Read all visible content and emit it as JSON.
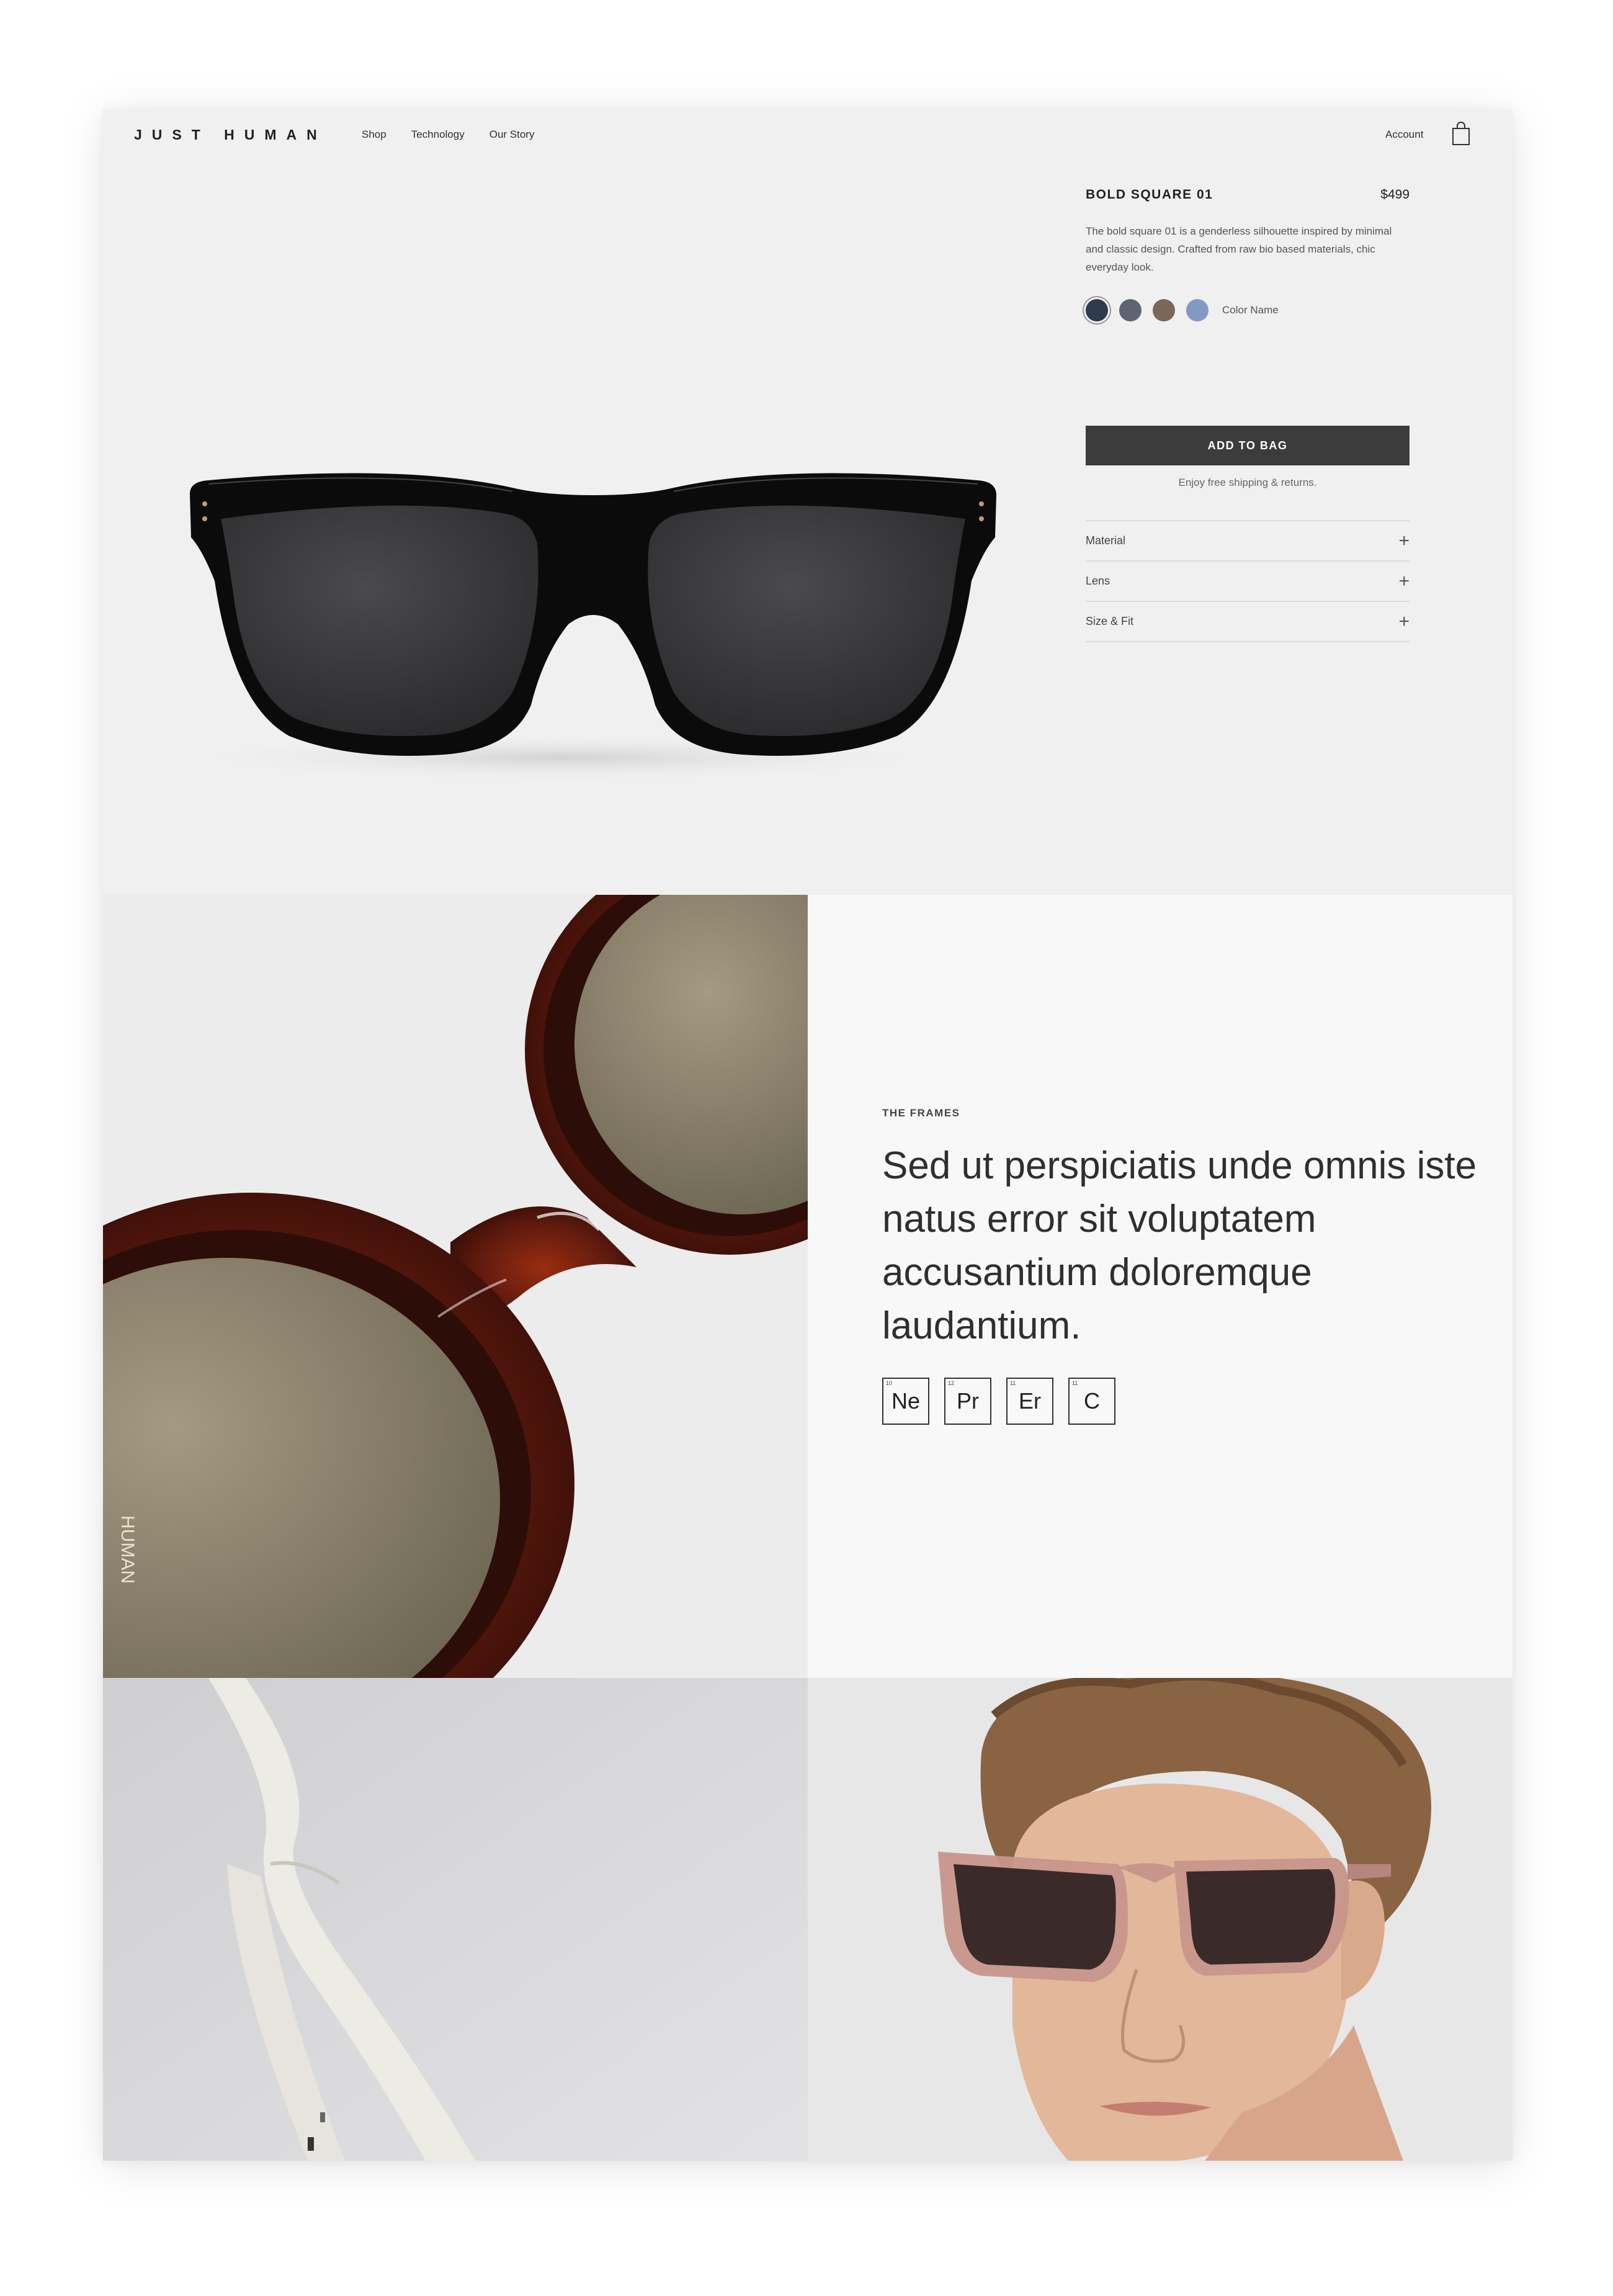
{
  "header": {
    "logo": "JUST HUMAN",
    "nav": [
      "Shop",
      "Technology",
      "Our Story"
    ],
    "account": "Account",
    "bag_icon": "shopping-bag-icon"
  },
  "product": {
    "name": "BOLD SQUARE 01",
    "price": "$499",
    "description": "The bold square 01 is a genderless silhouette inspired by minimal and classic design. Crafted from raw bio based materials, chic everyday look.",
    "swatches": [
      {
        "color": "#2e3a4e",
        "selected": true
      },
      {
        "color": "#5f6473",
        "selected": false
      },
      {
        "color": "#7c6656",
        "selected": false
      },
      {
        "color": "#8299c2",
        "selected": false
      }
    ],
    "color_name": "Color Name",
    "add_to_bag": "ADD TO BAG",
    "shipping_note": "Enjoy free shipping & returns.",
    "accordion": [
      "Material",
      "Lens",
      "Size & Fit"
    ],
    "accordion_icon": "plus-icon"
  },
  "frames": {
    "eyebrow": "THE FRAMES",
    "headline": "Sed ut perspiciatis unde omnis iste natus error sit voluptatem accusantium doloremque laudantium.",
    "elements": [
      {
        "symbol": "Ne",
        "number": "10"
      },
      {
        "symbol": "Pr",
        "number": "12"
      },
      {
        "symbol": "Er",
        "number": "11"
      },
      {
        "symbol": "C",
        "number": "11"
      }
    ],
    "temple_imprint": "HUMAN"
  },
  "colors": {
    "page_bg": "#f0f0f0",
    "button": "#3c3c3c",
    "panel": "#f8f8f8"
  }
}
